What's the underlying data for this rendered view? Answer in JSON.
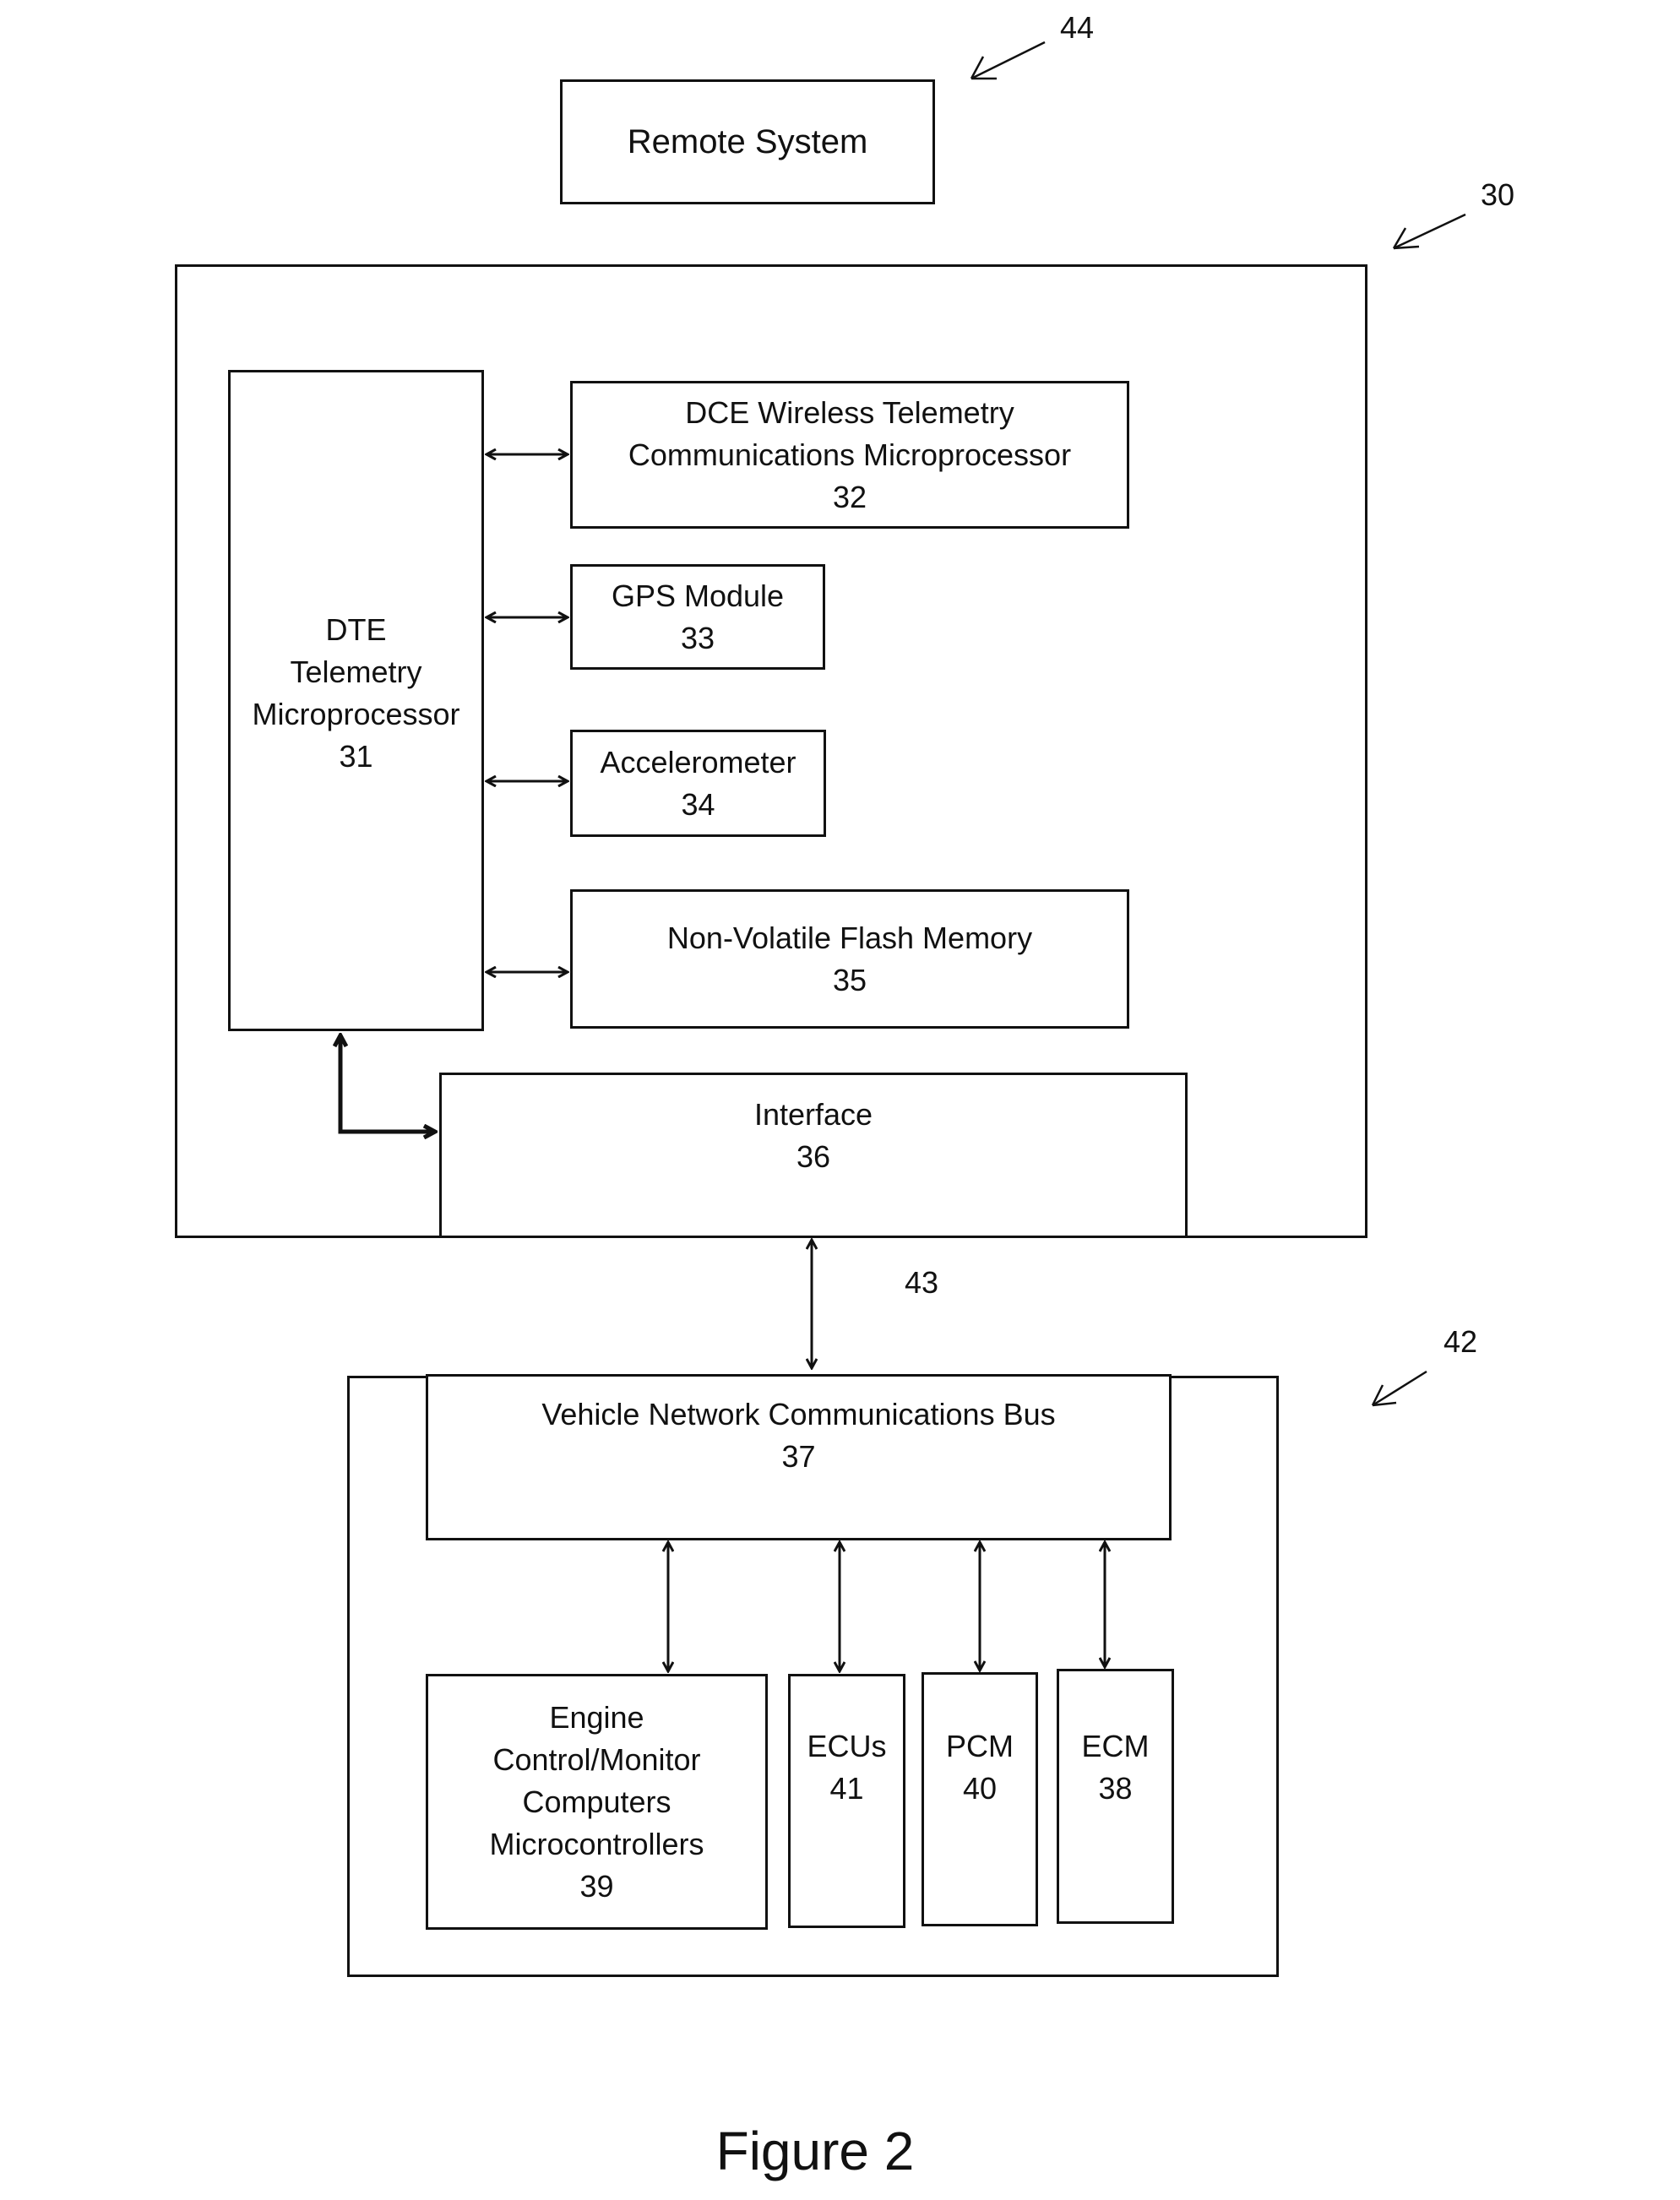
{
  "figure_caption": "Figure 2",
  "reference_labels": {
    "remote": "44",
    "telematics": "30",
    "vehicle": "42",
    "link": "43"
  },
  "remote_system": {
    "title": "Remote System"
  },
  "telematics_unit": {
    "dte": {
      "lines": [
        "DTE",
        "Telemetry",
        "Microprocessor"
      ],
      "number": "31"
    },
    "dce": {
      "lines": [
        "DCE Wireless Telemetry",
        "Communications Microprocessor"
      ],
      "number": "32"
    },
    "gps": {
      "lines": [
        "GPS Module"
      ],
      "number": "33"
    },
    "accelerometer": {
      "lines": [
        "Accelerometer"
      ],
      "number": "34"
    },
    "flash": {
      "lines": [
        "Non-Volatile Flash Memory"
      ],
      "number": "35"
    },
    "interface": {
      "lines": [
        "Interface"
      ],
      "number": "36"
    }
  },
  "vehicle": {
    "bus": {
      "lines": [
        "Vehicle Network Communications Bus"
      ],
      "number": "37"
    },
    "engine": {
      "lines": [
        "Engine",
        "Control/Monitor",
        "Computers",
        "Microcontrollers"
      ],
      "number": "39"
    },
    "ecus": {
      "lines": [
        "ECUs"
      ],
      "number": "41"
    },
    "pcm": {
      "lines": [
        "PCM"
      ],
      "number": "40"
    },
    "ecm": {
      "lines": [
        "ECM"
      ],
      "number": "38"
    }
  }
}
